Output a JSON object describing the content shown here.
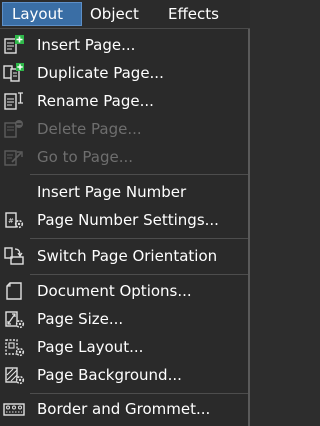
{
  "menubar": {
    "items": [
      {
        "label": "Layout",
        "active": true
      },
      {
        "label": "Object"
      },
      {
        "label": "Effects"
      }
    ]
  },
  "menu": {
    "items": [
      {
        "label": "Insert Page...",
        "icon": "insert-page-icon",
        "enabled": true
      },
      {
        "label": "Duplicate Page...",
        "icon": "duplicate-page-icon",
        "enabled": true
      },
      {
        "label": "Rename Page...",
        "icon": "rename-page-icon",
        "enabled": true
      },
      {
        "label": "Delete Page...",
        "icon": "delete-page-icon",
        "enabled": false
      },
      {
        "label": "Go to Page...",
        "icon": "go-to-page-icon",
        "enabled": false
      },
      {
        "label": "Insert Page Number",
        "icon": null,
        "enabled": true
      },
      {
        "label": "Page Number Settings...",
        "icon": "page-number-settings-icon",
        "enabled": true
      },
      {
        "label": "Switch Page Orientation",
        "icon": "switch-orientation-icon",
        "enabled": true
      },
      {
        "label": "Document Options...",
        "icon": "document-options-icon",
        "enabled": true
      },
      {
        "label": "Page Size...",
        "icon": "page-size-icon",
        "enabled": true
      },
      {
        "label": "Page Layout...",
        "icon": "page-layout-icon",
        "enabled": true
      },
      {
        "label": "Page Background...",
        "icon": "page-background-icon",
        "enabled": true
      },
      {
        "label": "Border and Grommet...",
        "icon": "border-grommet-icon",
        "enabled": true
      }
    ]
  },
  "colors": {
    "menu_background": "#2a2a2a",
    "active_menu_highlight": "#3a6ea5",
    "add_accent": "#2fb84a",
    "disabled_text": "#6e6e6e"
  }
}
